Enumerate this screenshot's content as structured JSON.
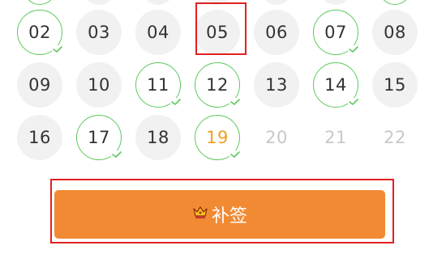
{
  "calendar": {
    "row1": [
      {
        "label": "02",
        "signed": true
      },
      {
        "label": "03",
        "signed": false
      },
      {
        "label": "04",
        "signed": false
      },
      {
        "label": "05",
        "signed": false
      },
      {
        "label": "06",
        "signed": false
      },
      {
        "label": "07",
        "signed": true
      },
      {
        "label": "08",
        "signed": false
      }
    ],
    "row2": [
      {
        "label": "09",
        "signed": false
      },
      {
        "label": "10",
        "signed": false
      },
      {
        "label": "11",
        "signed": true
      },
      {
        "label": "12",
        "signed": true
      },
      {
        "label": "13",
        "signed": false
      },
      {
        "label": "14",
        "signed": true
      },
      {
        "label": "15",
        "signed": false
      }
    ],
    "row3": [
      {
        "label": "16",
        "signed": false
      },
      {
        "label": "17",
        "signed": true
      },
      {
        "label": "18",
        "signed": false
      },
      {
        "label": "19",
        "signed": true,
        "today": true
      },
      {
        "label": "20",
        "future": true
      },
      {
        "label": "21",
        "future": true
      },
      {
        "label": "22",
        "future": true
      }
    ]
  },
  "makeup_button": {
    "label": "补签",
    "icon": "crown-icon"
  },
  "colors": {
    "signed_ring": "#5cc85c",
    "button": "#f28a33",
    "today_text": "#f0a020",
    "highlight": "#e02020"
  }
}
